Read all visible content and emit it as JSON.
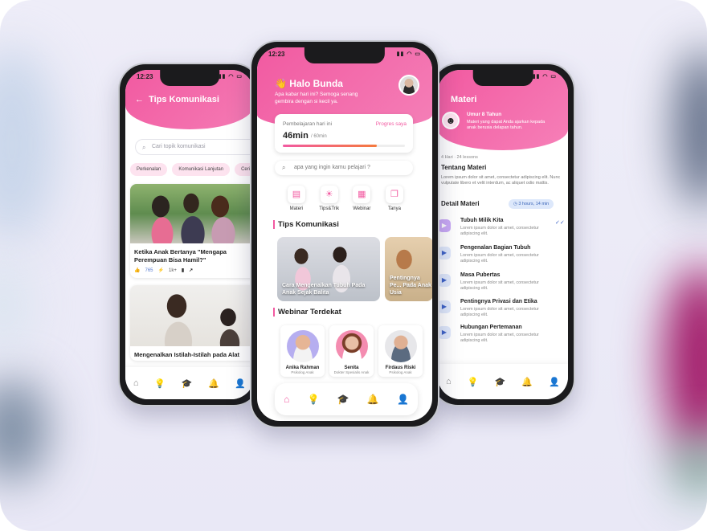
{
  "left_phone": {
    "time": "12:23",
    "title": "Tips Komunikasi",
    "search_placeholder": "Cari topik komunikasi",
    "chips": [
      "Perkenalan",
      "Komunikasi Lanjutan",
      "Cerita"
    ],
    "cards": [
      {
        "caption": "Ketika Anak Bertanya \"Mengapa Perempuan Bisa Hamil?\"",
        "likes": "765",
        "views": "1k+"
      },
      {
        "caption": "Mengenalkan Istilah-Istilah pada Alat"
      }
    ]
  },
  "center_phone": {
    "time": "12:23",
    "greeting": "Halo Bunda",
    "greeting_sub": "Apa kabar hari ini? Semoga senang gembira dengan si kecil ya.",
    "progress": {
      "label": "Pembelajaran hari ini",
      "link": "Progres saya",
      "value": "46min",
      "max": "/ 60min",
      "fraction": 0.77
    },
    "search_placeholder": "apa yang ingin kamu pelajari ?",
    "categories": [
      {
        "label": "Materi",
        "icon": "book-icon"
      },
      {
        "label": "Tips&Trik",
        "icon": "sun-icon"
      },
      {
        "label": "Webinar",
        "icon": "calendar-icon"
      },
      {
        "label": "Tanya",
        "icon": "chat-icon"
      }
    ],
    "section_tips": "Tips Komunikasi",
    "tips": [
      {
        "caption": "Cara Mengenalkan Tubuh Pada Anak Sejak Balita"
      },
      {
        "caption": "Pentingnya Pe... Pada Anak Usia"
      }
    ],
    "section_webinar": "Webinar Terdekat",
    "webinars": [
      {
        "name": "Anika Rahman",
        "role": "Psikolog Anak"
      },
      {
        "name": "Senita",
        "role": "Dokter Spesialis Anak"
      },
      {
        "name": "Firdaus Riski",
        "role": "Psikolog Anak"
      }
    ]
  },
  "right_phone": {
    "title": "Materi",
    "age": "Umur 8 Tahun",
    "age_desc": "Materi yang dapat Anda ajarkan kepada anak berusia delapan tahun.",
    "meta": "4 Hari · 24 lessons",
    "about_title": "Tentang Materi",
    "about_text": "Lorem ipsum dolor sit amet, consectetur adipiscing elit. Nunc vulputate libero et velit interdum, ac aliquet odio mattis.",
    "detail_title": "Detail Materi",
    "duration": "3 hours, 14 min",
    "lessons": [
      {
        "title": "Tubuh Milik Kita",
        "desc": "Lorem ipsum dolor sit amet, consectetur adipiscing elit."
      },
      {
        "title": "Pengenalan Bagian Tubuh",
        "desc": "Lorem ipsum dolor sit amet, consectetur adipiscing elit."
      },
      {
        "title": "Masa Pubertas",
        "desc": "Lorem ipsum dolor sit amet, consectetur adipiscing elit."
      },
      {
        "title": "Pentingnya Privasi dan Etika",
        "desc": "Lorem ipsum dolor sit amet, consectetur adipiscing elit."
      },
      {
        "title": "Hubungan Pertemanan",
        "desc": "Lorem ipsum dolor sit amet, consectetur adipiscing elit."
      }
    ]
  },
  "colors": {
    "accent": "#f25aa1",
    "blue": "#3e63c7",
    "background": "#eeedf8"
  }
}
